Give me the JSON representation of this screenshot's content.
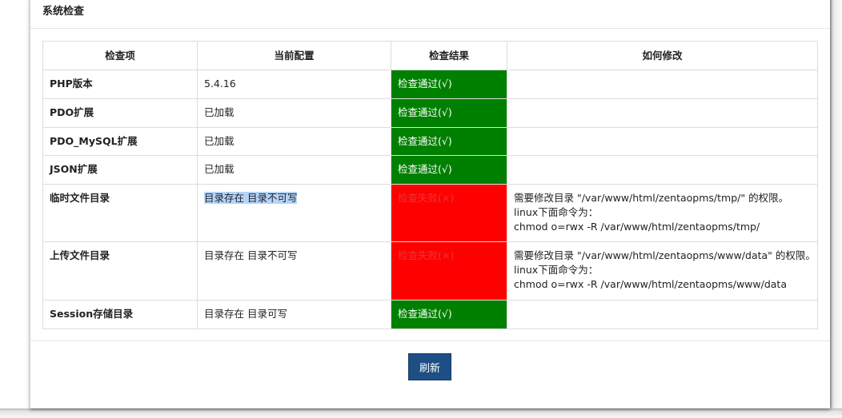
{
  "panel": {
    "title": "系统检查"
  },
  "table": {
    "headers": [
      "检查项",
      "当前配置",
      "检查结果",
      "如何修改"
    ],
    "rows": [
      {
        "item": "PHP版本",
        "config": "5.4.16",
        "result": "检查通过(√)",
        "status": "pass",
        "fix": []
      },
      {
        "item": "PDO扩展",
        "config": "已加载",
        "result": "检查通过(√)",
        "status": "pass",
        "fix": []
      },
      {
        "item": "PDO_MySQL扩展",
        "config": "已加载",
        "result": "检查通过(√)",
        "status": "pass",
        "fix": []
      },
      {
        "item": "JSON扩展",
        "config": "已加载",
        "result": "检查通过(√)",
        "status": "pass",
        "fix": []
      },
      {
        "item": "临时文件目录",
        "config": "目录存在 目录不可写",
        "result": "检查失败(×)",
        "status": "fail",
        "fix": [
          "需要修改目录 \"/var/www/html/zentaopms/tmp/\" 的权限。",
          "linux下面命令为：",
          "chmod o=rwx -R /var/www/html/zentaopms/tmp/"
        ]
      },
      {
        "item": "上传文件目录",
        "config": "目录存在 目录不可写",
        "result": "检查失败(×)",
        "status": "fail",
        "fix": [
          "需要修改目录 \"/var/www/html/zentaopms/www/data\" 的权限。",
          "linux下面命令为：",
          "chmod o=rwx -R /var/www/html/zentaopms/www/data"
        ]
      },
      {
        "item": "Session存储目录",
        "config": "目录存在 目录可写",
        "result": "检查通过(√)",
        "status": "pass",
        "fix": []
      }
    ]
  },
  "footer": {
    "refresh_label": "刷新"
  },
  "colors": {
    "pass": "#008000",
    "fail": "#ff0000",
    "button": "#1d4f85"
  }
}
